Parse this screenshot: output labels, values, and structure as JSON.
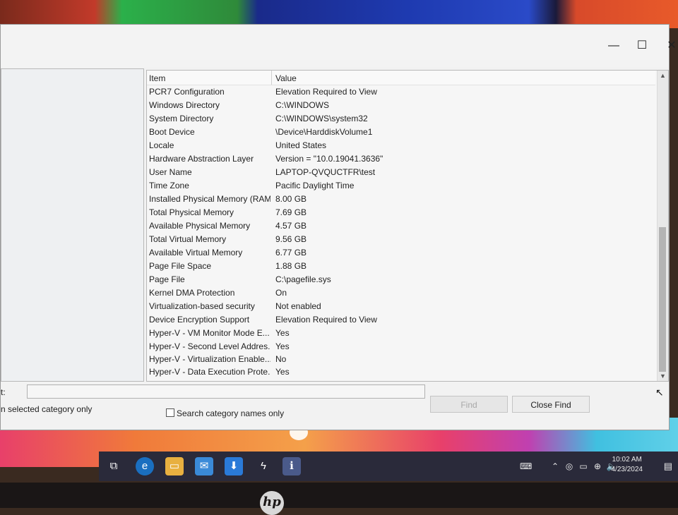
{
  "window": {
    "controls": {
      "minimize": "—",
      "maximize": "☐",
      "close": "✕"
    }
  },
  "list": {
    "headers": {
      "item": "Item",
      "value": "Value"
    },
    "rows": [
      {
        "item": "PCR7 Configuration",
        "value": "Elevation Required to View"
      },
      {
        "item": "Windows Directory",
        "value": "C:\\WINDOWS"
      },
      {
        "item": "System Directory",
        "value": "C:\\WINDOWS\\system32"
      },
      {
        "item": "Boot Device",
        "value": "\\Device\\HarddiskVolume1"
      },
      {
        "item": "Locale",
        "value": "United States"
      },
      {
        "item": "Hardware Abstraction Layer",
        "value": "Version = \"10.0.19041.3636\""
      },
      {
        "item": "User Name",
        "value": "LAPTOP-QVQUCTFR\\test"
      },
      {
        "item": "Time Zone",
        "value": "Pacific Daylight Time"
      },
      {
        "item": "Installed Physical Memory (RAM)",
        "value": "8.00 GB"
      },
      {
        "item": "Total Physical Memory",
        "value": "7.69 GB"
      },
      {
        "item": "Available Physical Memory",
        "value": "4.57 GB"
      },
      {
        "item": "Total Virtual Memory",
        "value": "9.56 GB"
      },
      {
        "item": "Available Virtual Memory",
        "value": "6.77 GB"
      },
      {
        "item": "Page File Space",
        "value": "1.88 GB"
      },
      {
        "item": "Page File",
        "value": "C:\\pagefile.sys"
      },
      {
        "item": "Kernel DMA Protection",
        "value": "On"
      },
      {
        "item": "Virtualization-based security",
        "value": "Not enabled"
      },
      {
        "item": "Device Encryption Support",
        "value": "Elevation Required to View"
      },
      {
        "item": "Hyper-V - VM Monitor Mode E...",
        "value": "Yes"
      },
      {
        "item": "Hyper-V - Second Level Addres...",
        "value": "Yes"
      },
      {
        "item": "Hyper-V - Virtualization Enable...",
        "value": "No"
      },
      {
        "item": "Hyper-V - Data Execution Prote...",
        "value": "Yes"
      }
    ]
  },
  "find": {
    "label": "t:",
    "input_value": "",
    "find_button": "Find",
    "close_find_button": "Close Find",
    "option_selected_category": "n selected category only",
    "option_search_names": "Search category names only"
  },
  "taskbar": {
    "clock_time": "10:02 AM",
    "clock_date": "4/23/2024"
  }
}
